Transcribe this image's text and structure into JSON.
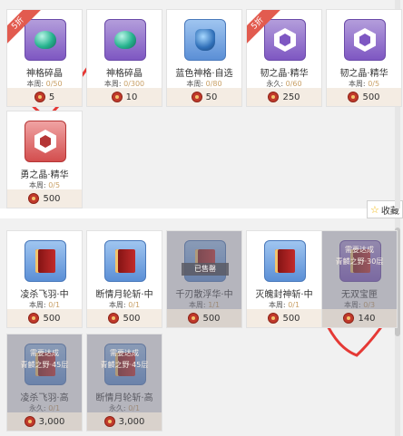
{
  "top_cards": [
    {
      "name": "神格碎晶",
      "limit_prefix": "本周:",
      "limit_value": "0/50",
      "price": "5",
      "badge": "5折",
      "icon": "jade-crystal-icon"
    },
    {
      "name": "神格碎晶",
      "limit_prefix": "本周:",
      "limit_value": "0/300",
      "price": "10",
      "icon": "jade-crystal-icon"
    },
    {
      "name": "蓝色神格·自选",
      "limit_prefix": "本周:",
      "limit_value": "0/80",
      "price": "50",
      "icon": "blue-bag-icon"
    },
    {
      "name": "韧之晶·精华",
      "limit_prefix": "永久:",
      "limit_value": "0/60",
      "price": "250",
      "badge": "5折",
      "icon": "purple-crystal-icon"
    },
    {
      "name": "韧之晶·精华",
      "limit_prefix": "本周:",
      "limit_value": "0/5",
      "price": "500",
      "icon": "purple-crystal-icon"
    },
    {
      "name": "勇之晶·精华",
      "limit_prefix": "本周:",
      "limit_value": "0/5",
      "price": "500",
      "icon": "red-crystal-icon"
    }
  ],
  "bottom_cards": [
    {
      "name": "凌杀飞羽·中",
      "limit_prefix": "本周:",
      "limit_value": "0/1",
      "price": "500",
      "icon": "red-book-icon"
    },
    {
      "name": "断情月轮斩·中",
      "limit_prefix": "本周:",
      "limit_value": "0/1",
      "price": "500",
      "icon": "red-book-icon"
    },
    {
      "name": "千刃散浮华·中",
      "limit_prefix": "本周:",
      "limit_value": "1/1",
      "price": "500",
      "sold": "已售罄",
      "icon": "red-book-icon"
    },
    {
      "name": "灭魄封神斩·中",
      "limit_prefix": "本周:",
      "limit_value": "0/1",
      "price": "500",
      "icon": "red-book-icon"
    },
    {
      "name": "无双宝匣",
      "limit_prefix": "本周:",
      "limit_value": "0/3",
      "price": "140",
      "lock_text": "需要达成\n青麟之野·30层",
      "icon": "treasure-box-icon"
    },
    {
      "name": "凌杀飞羽·高",
      "limit_prefix": "永久:",
      "limit_value": "0/1",
      "price": "3,000",
      "lock_text": "需要达成\n青麟之野·45层",
      "icon": "red-book-icon"
    },
    {
      "name": "断情月轮斩·高",
      "limit_prefix": "永久:",
      "limit_value": "0/1",
      "price": "3,000",
      "lock_text": "需要达成\n青麟之野·45层",
      "icon": "red-book-icon"
    }
  ],
  "favorite": {
    "label": "收藏"
  },
  "colors": {
    "annotation": "#e53935",
    "accent": "#c9a066",
    "badge": "#e25b4f"
  }
}
